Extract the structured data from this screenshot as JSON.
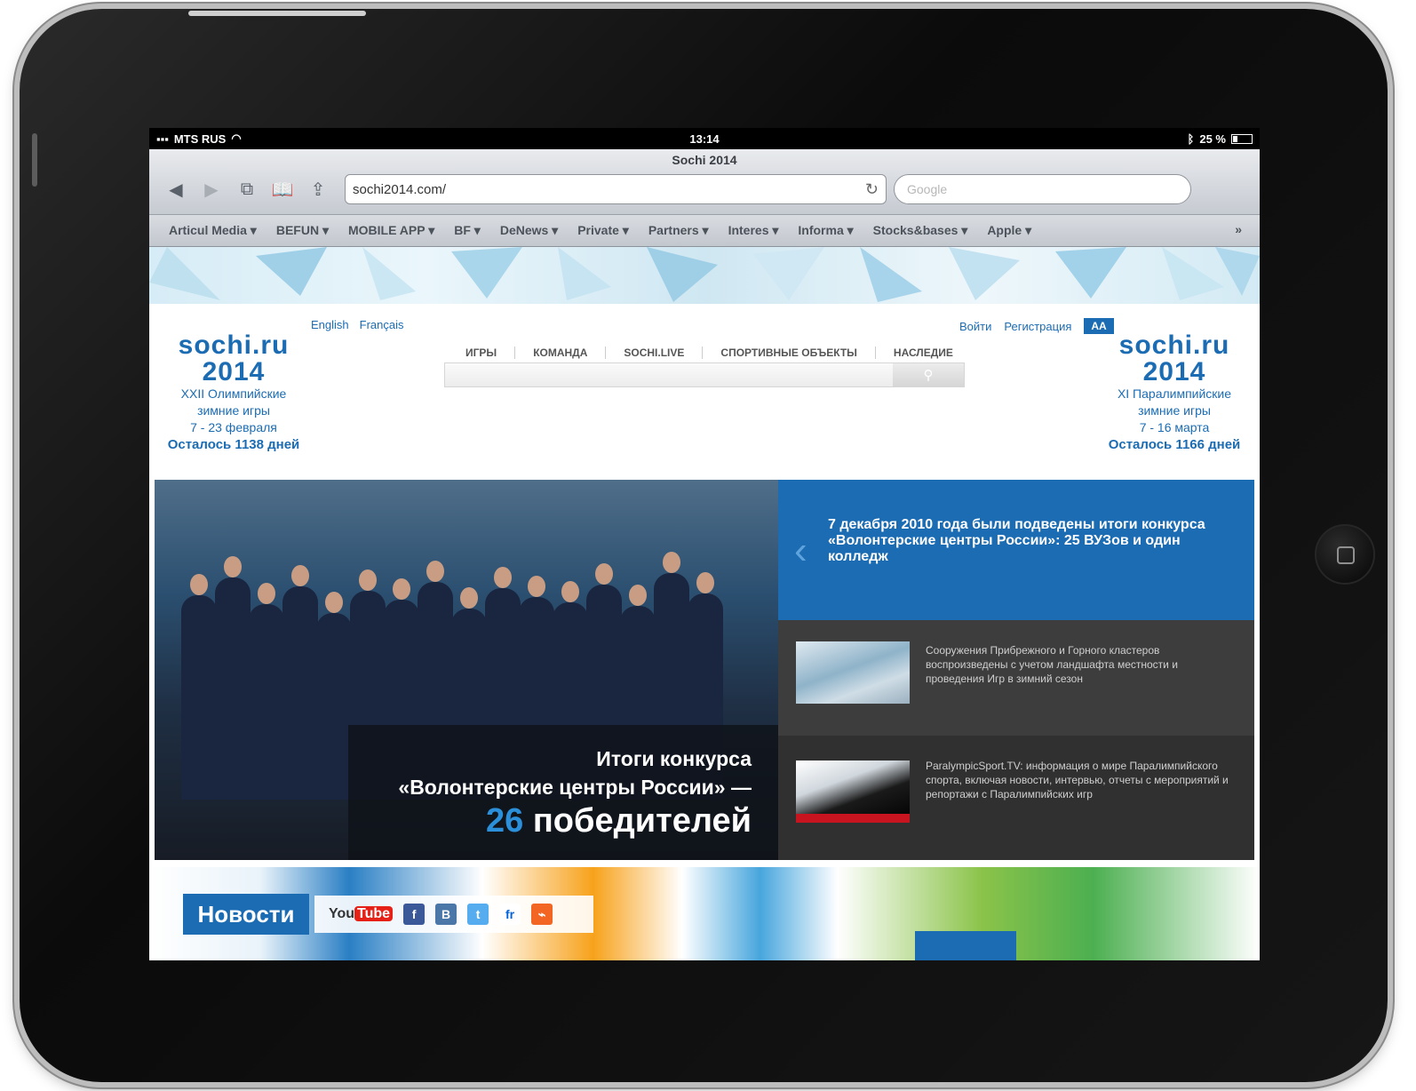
{
  "status_bar": {
    "carrier": "MTS RUS",
    "time": "13:14",
    "battery": "25 %"
  },
  "browser": {
    "page_title": "Sochi 2014",
    "url": "sochi2014.com/",
    "search_placeholder": "Google",
    "bookmarks": [
      "Articul Media ▾",
      "BEFUN ▾",
      "MOBILE APP ▾",
      "BF ▾",
      "DeNews ▾",
      "Private ▾",
      "Partners ▾",
      "Interes ▾",
      "Informa ▾",
      "Stocks&bases ▾",
      "Apple ▾"
    ],
    "bookmarks_more": "»"
  },
  "site": {
    "lang": {
      "english": "English",
      "francais": "Français"
    },
    "auth": {
      "login": "Войти",
      "register": "Регистрация",
      "font_size": "AA"
    },
    "logo_left": {
      "brand": "sochi.ru 2014",
      "line1": "XXII Олимпийские",
      "line2": "зимние игры",
      "line3": "7 - 23 февраля",
      "countdown": "Осталось 1138 дней"
    },
    "logo_right": {
      "brand": "sochi.ru 2014",
      "line1": "XI Паралимпийские",
      "line2": "зимние игры",
      "line3": "7 - 16 марта",
      "countdown": "Осталось 1166 дней"
    },
    "nav": [
      "ИГРЫ",
      "КОМАНДА",
      "SOCHI.LIVE",
      "СПОРТИВНЫЕ ОБЪЕКТЫ",
      "НАСЛЕДИЕ"
    ],
    "feature": {
      "caption_line1": "Итоги конкурса",
      "caption_line2": "«Волонтерские центры России» —",
      "caption_number": "26",
      "caption_word": "победителей"
    },
    "headline": "7 декабря 2010 года были подведены итоги конкурса «Волонтерские центры России»: 25 ВУЗов и один колледж",
    "news": [
      {
        "text": "Сооружения Прибрежного и Горного кластеров воспроизведены с учетом ландшафта местности и проведения Игр в зимний сезон"
      },
      {
        "text": "ParalympicSport.TV: информация о мире Паралимпийского спорта, включая новости, интервью, отчеты с мероприятий и репортажи с Паралимпийских игр"
      }
    ],
    "news_tab": "Новости",
    "social": {
      "youtube_you": "You",
      "youtube_tube": "Tube",
      "facebook": "f",
      "vk": "B",
      "twitter": "t",
      "flickr": "fr",
      "rss": "⌁"
    }
  },
  "colors": {
    "accent": "#1b6cb3",
    "caption_number": "#2b8fd9",
    "youtube": "#e62117"
  }
}
